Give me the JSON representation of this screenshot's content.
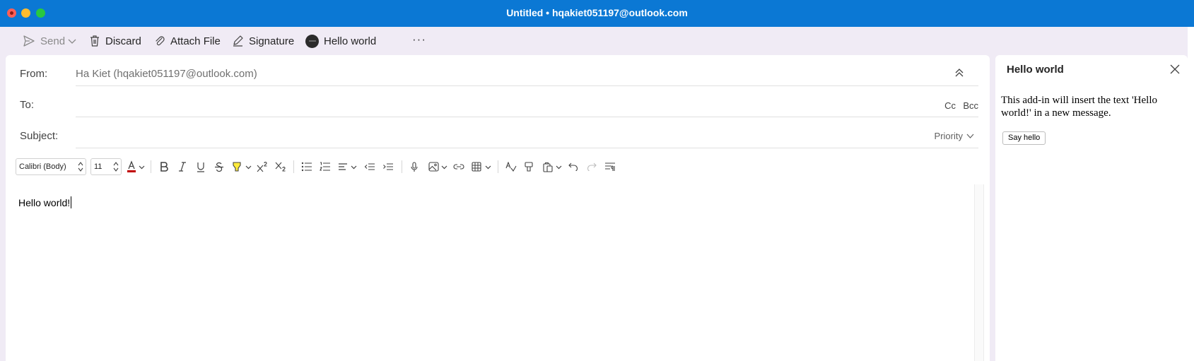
{
  "window": {
    "title": "Untitled • hqakiet051197@outlook.com"
  },
  "toolbar": {
    "send": "Send",
    "discard": "Discard",
    "attach": "Attach File",
    "signature": "Signature",
    "addin": "Hello world",
    "more": "···"
  },
  "compose": {
    "from_label": "From:",
    "from_value": "Ha Kiet (hqakiet051197@outlook.com)",
    "to_label": "To:",
    "cc": "Cc",
    "bcc": "Bcc",
    "subject_label": "Subject:",
    "priority": "Priority",
    "body": "Hello world!"
  },
  "format": {
    "font": "Calibri (Body)",
    "size": "11",
    "font_color": "#c00000",
    "highlight_color": "#ffeb3b"
  },
  "addin_pane": {
    "title": "Hello world",
    "description": "This add-in will insert the text 'Hello world!' in a new message.",
    "button": "Say hello"
  }
}
